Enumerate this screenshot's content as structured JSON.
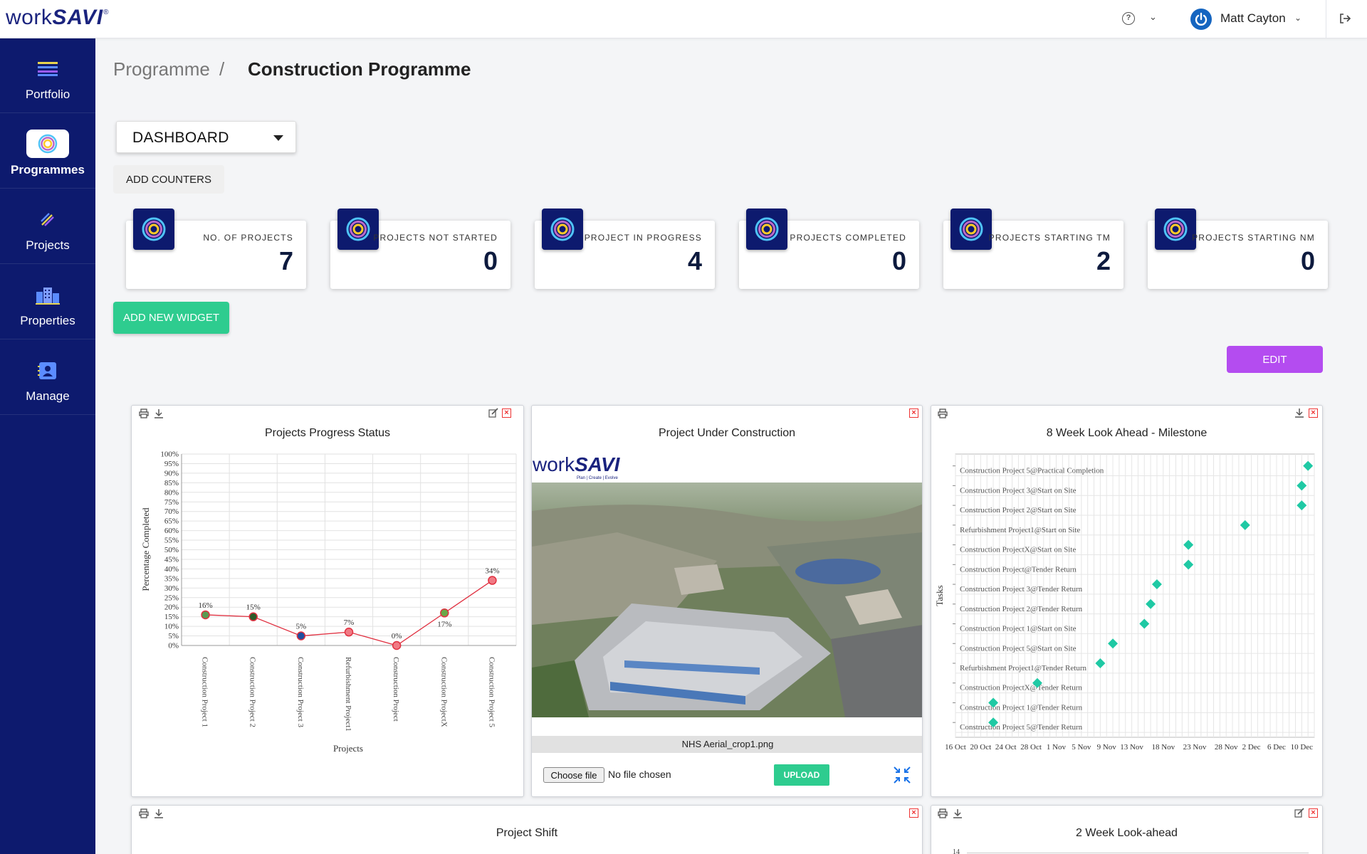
{
  "brand": {
    "name_a": "work",
    "name_b": "SAVI",
    "reg": "®"
  },
  "topbar": {
    "help": "?",
    "user_name": "Matt Cayton"
  },
  "sidebar": {
    "items": [
      {
        "label": "Portfolio"
      },
      {
        "label": "Programmes"
      },
      {
        "label": "Projects"
      },
      {
        "label": "Properties"
      },
      {
        "label": "Manage"
      }
    ]
  },
  "breadcrumb": {
    "parent": "Programme",
    "separator": "/",
    "current": "Construction Programme"
  },
  "view_select": {
    "value": "DASHBOARD"
  },
  "buttons": {
    "add_counters": "ADD COUNTERS",
    "add_widget": "ADD NEW WIDGET",
    "edit": "EDIT",
    "upload": "UPLOAD",
    "choose_file": "Choose file"
  },
  "counters": [
    {
      "label": "NO. OF PROJECTS",
      "value": "7"
    },
    {
      "label": "PROJECTS NOT STARTED",
      "value": "0"
    },
    {
      "label": "PROJECT IN PROGRESS",
      "value": "4"
    },
    {
      "label": "PROJECTS COMPLETED",
      "value": "0"
    },
    {
      "label": "PROJECTS STARTING TM",
      "value": "2"
    },
    {
      "label": "PROJECTS STARTING NM",
      "value": "0"
    }
  ],
  "widgets": {
    "progress": {
      "title": "Projects Progress Status"
    },
    "image": {
      "title": "Project Under Construction",
      "file_caption": "NHS Aerial_crop1.png",
      "no_file": "No file chosen",
      "logo_tagline": "Plan | Create | Evolve"
    },
    "milestone": {
      "title": "8 Week Look Ahead - Milestone"
    },
    "shift": {
      "title": "Project Shift"
    },
    "lookahead": {
      "title": "2 Week Look-ahead",
      "first_tick": "14"
    }
  },
  "chart_data": [
    {
      "type": "line",
      "title": "Projects Progress Status",
      "xlabel": "Projects",
      "ylabel": "Percentage Completed",
      "ylim": [
        0,
        100
      ],
      "yticks": [
        "0%",
        "5%",
        "10%",
        "15%",
        "20%",
        "25%",
        "30%",
        "35%",
        "40%",
        "45%",
        "50%",
        "55%",
        "60%",
        "65%",
        "70%",
        "75%",
        "80%",
        "85%",
        "90%",
        "95%",
        "100%"
      ],
      "categories": [
        "Construction Project 1",
        "Construction Project 2",
        "Construction Project 3",
        "Refurbishment Project1",
        "Construction Project",
        "Construction ProjectX",
        "Construction Project 5"
      ],
      "values": [
        16,
        15,
        5,
        7,
        0,
        17,
        34
      ],
      "data_labels": [
        "16%",
        "15%",
        "5%",
        "7%",
        "0%",
        "17%",
        "34%"
      ],
      "marker_colors": [
        "#5a9a52",
        "#2e5a2a",
        "#1f4fa0",
        "#f07a84",
        "#f07a84",
        "#6aa848",
        "#f07a84"
      ],
      "line_color": "#e03040",
      "grid": true
    },
    {
      "type": "scatter",
      "title": "8 Week Look Ahead - Milestone",
      "ylabel": "Tasks",
      "x_tick_labels": [
        "16 Oct",
        "20 Oct",
        "24 Oct",
        "28 Oct",
        "1 Nov",
        "5 Nov",
        "9 Nov",
        "13 Nov",
        "18 Nov",
        "23 Nov",
        "28 Nov",
        "2 Dec",
        "6 Dec",
        "10 Dec"
      ],
      "xlim": [
        "16 Oct",
        "12 Dec"
      ],
      "marker_color": "#1fc9a4",
      "grid": true,
      "points": [
        {
          "task": "Construction Project 5@Practical Completion",
          "date": "11 Dec"
        },
        {
          "task": "Construction Project 3@Start on Site",
          "date": "10 Dec"
        },
        {
          "task": "Construction Project 2@Start on Site",
          "date": "10 Dec"
        },
        {
          "task": "Refurbishment Project1@Start on Site",
          "date": "1 Dec"
        },
        {
          "task": "Construction ProjectX@Start on Site",
          "date": "22 Nov"
        },
        {
          "task": "Construction Project@Tender Return",
          "date": "22 Nov"
        },
        {
          "task": "Construction Project 3@Tender Return",
          "date": "17 Nov"
        },
        {
          "task": "Construction Project 2@Tender Return",
          "date": "16 Nov"
        },
        {
          "task": "Construction Project 1@Start on Site",
          "date": "15 Nov"
        },
        {
          "task": "Construction Project 5@Start on Site",
          "date": "10 Nov"
        },
        {
          "task": "Refurbishment Project1@Tender Return",
          "date": "8 Nov"
        },
        {
          "task": "Construction ProjectX@Tender Return",
          "date": "29 Oct"
        },
        {
          "task": "Construction Project 1@Tender Return",
          "date": "22 Oct"
        },
        {
          "task": "Construction Project 5@Tender Return",
          "date": "22 Oct"
        }
      ]
    }
  ]
}
